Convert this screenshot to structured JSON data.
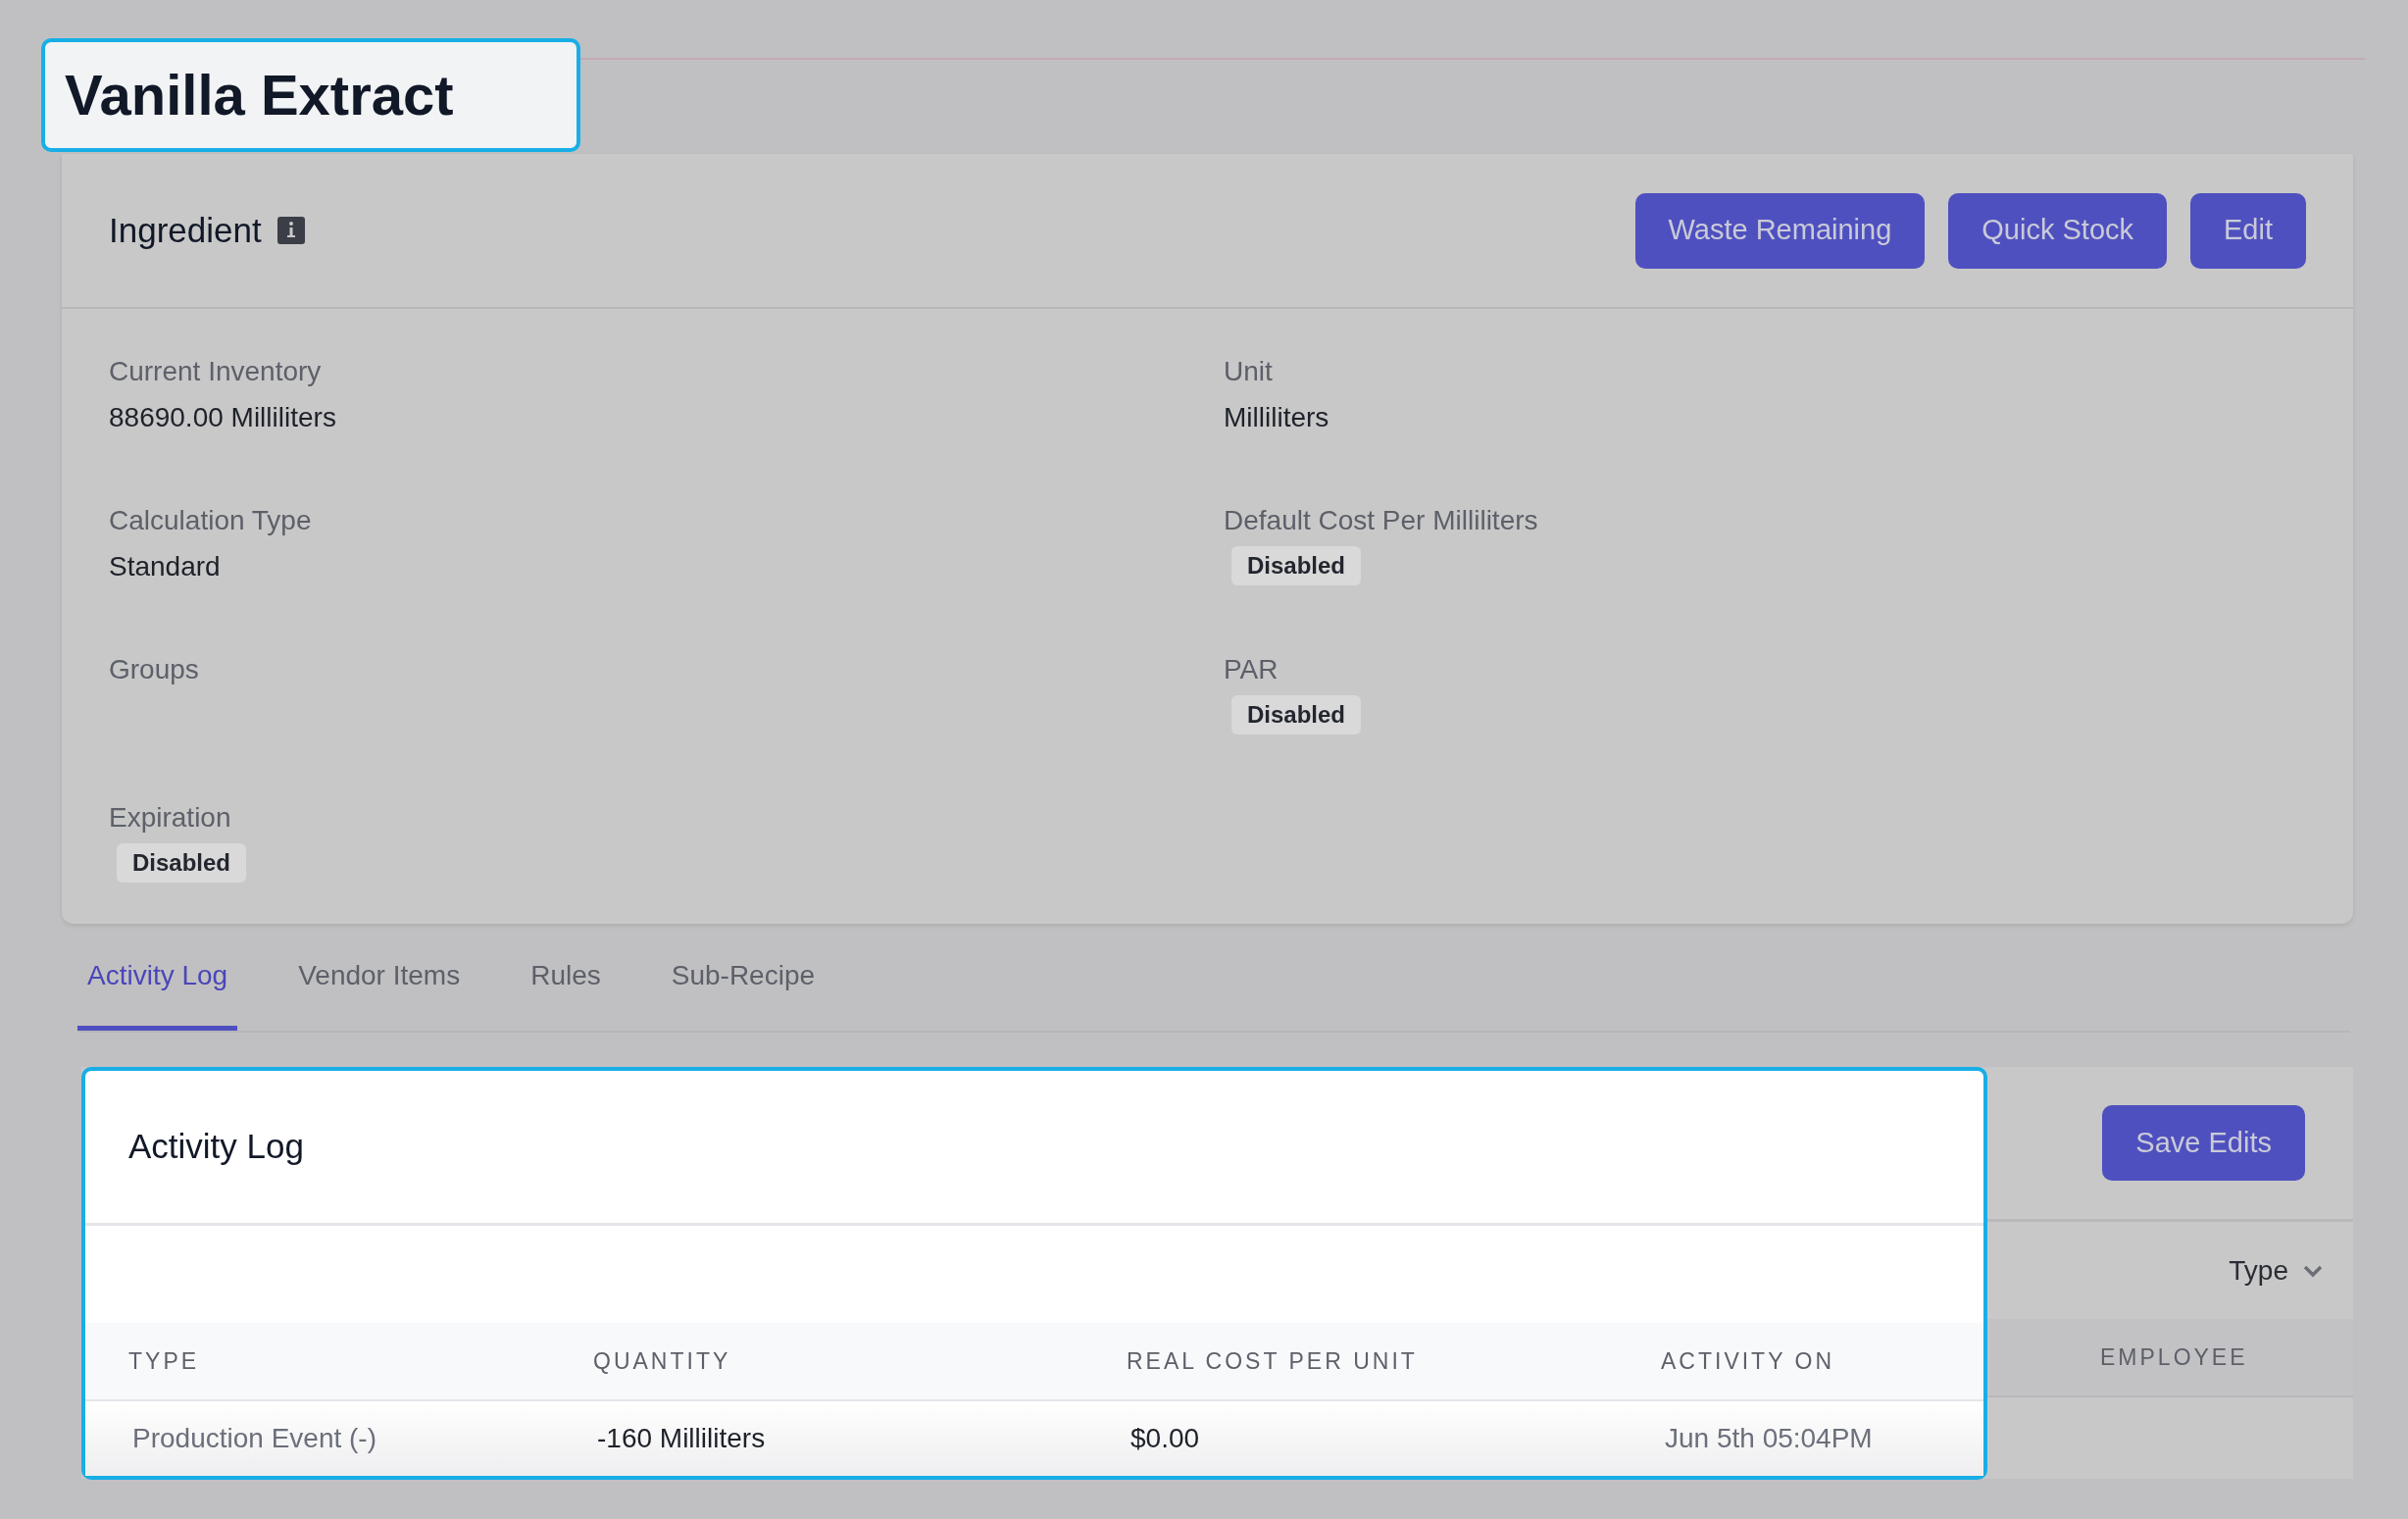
{
  "page_title": {
    "text": "Vanilla Extract",
    "highlighted": true
  },
  "ingredient_panel": {
    "title": "Ingredient",
    "actions": [
      "Waste Remaining",
      "Quick Stock",
      "Edit"
    ],
    "fields": [
      {
        "label": "Current Inventory",
        "kind": "text",
        "value": "88690.00 Milliliters"
      },
      {
        "label": "Unit",
        "kind": "text",
        "value": "Milliliters"
      },
      {
        "label": "Calculation Type",
        "kind": "text",
        "value": "Standard"
      },
      {
        "label": "Default Cost Per Milliliters",
        "kind": "badge",
        "value": "Disabled"
      },
      {
        "label": "Groups",
        "kind": "empty"
      },
      {
        "label": "PAR",
        "kind": "badge",
        "value": "Disabled"
      },
      {
        "label": "Expiration",
        "kind": "badge",
        "value": "Disabled"
      }
    ]
  },
  "tabs": [
    {
      "label": "Activity Log",
      "selected": true
    },
    {
      "label": "Vendor Items",
      "selected": false
    },
    {
      "label": "Rules",
      "selected": false
    },
    {
      "label": "Sub-Recipe",
      "selected": false
    }
  ],
  "activity_log": {
    "title": "Activity Log",
    "save_button": "Save Edits",
    "filter": {
      "label": "Type"
    },
    "columns": [
      {
        "label": "TYPE",
        "highlighted": true
      },
      {
        "label": "QUANTITY",
        "highlighted": true
      },
      {
        "label": "REAL COST PER UNIT",
        "highlighted": true
      },
      {
        "label": "ACTIVITY ON",
        "highlighted": true
      },
      {
        "label": "EMPLOYEE",
        "highlighted": false
      }
    ],
    "rows": [
      [
        "Production Event (-)",
        "-160 Milliliters",
        "$0.00",
        "Jun 5th 05:04PM"
      ]
    ]
  }
}
